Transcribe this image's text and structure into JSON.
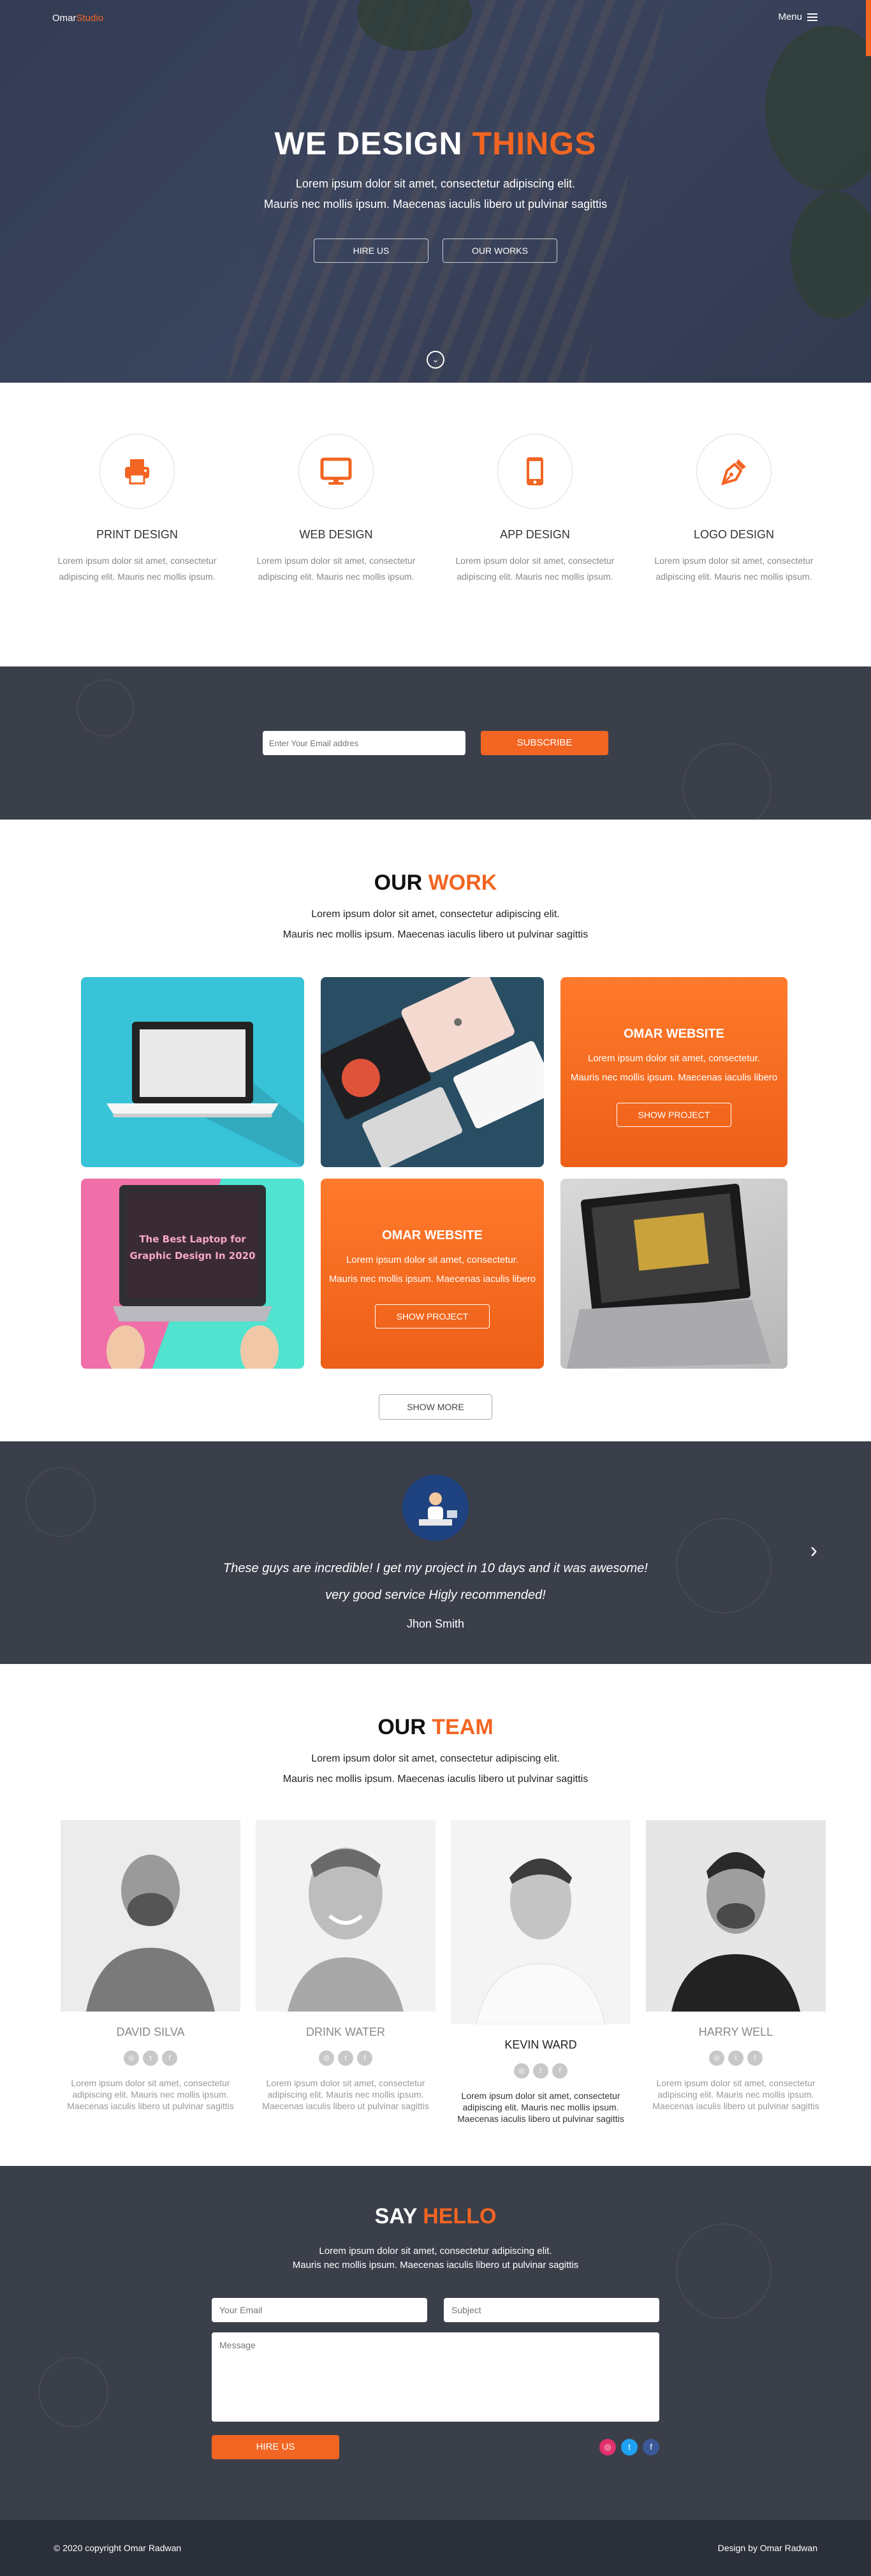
{
  "nav": {
    "logo_main": "Omar",
    "logo_accent": "Studio",
    "menu_label": "Menu"
  },
  "hero": {
    "title_main": "WE DESIGN ",
    "title_accent": "THINGS",
    "subtitle_line1": "Lorem ipsum dolor sit amet, consectetur adipiscing elit.",
    "subtitle_line2": "Mauris nec mollis ipsum. Maecenas iaculis libero ut pulvinar sagittis",
    "button_hire": "HIRE US",
    "button_works": "OUR WORKS"
  },
  "services": [
    {
      "title": "PRINT DESIGN",
      "text": "Lorem ipsum dolor sit amet, consectetur adipiscing elit. Mauris nec mollis ipsum.",
      "icon": "printer-icon"
    },
    {
      "title": "WEB DESIGN",
      "text": "Lorem ipsum dolor sit amet, consectetur adipiscing elit. Mauris nec mollis ipsum.",
      "icon": "monitor-icon"
    },
    {
      "title": "APP DESIGN",
      "text": "Lorem ipsum dolor sit amet, consectetur adipiscing elit. Mauris nec mollis ipsum.",
      "icon": "mobile-icon"
    },
    {
      "title": "LOGO DESIGN",
      "text": "Lorem ipsum dolor sit amet, consectetur adipiscing elit. Mauris nec mollis ipsum.",
      "icon": "pen-nib-icon"
    }
  ],
  "subscribe": {
    "placeholder": "Enter Your Email addres",
    "button": "SUBSCRIBE"
  },
  "work": {
    "title_main": "OUR ",
    "title_accent": "WORK",
    "sub_line1": "Lorem ipsum dolor sit amet, consectetur adipiscing elit.",
    "sub_line2": "Mauris nec mollis ipsum. Maecenas iaculis libero ut pulvinar sagittis",
    "overlay_title": "OMAR WEBSITE",
    "overlay_line1": "Lorem ipsum dolor sit amet, consectetur.",
    "overlay_line2": "Mauris nec mollis ipsum. Maecenas iaculis libero",
    "overlay_button": "SHOW PROJECT",
    "laptop_card_line1": "The Best Laptop for",
    "laptop_card_line2": "Graphic Design In 2020",
    "show_more": "SHOW MORE"
  },
  "testimonial": {
    "quote_line1": "These guys are incredible! I get my project in 10 days and it was awesome!",
    "quote_line2": "very good service Higly recommended!",
    "author": "Jhon Smith"
  },
  "team": {
    "title_main": "OUR ",
    "title_accent": "TEAM",
    "sub_line1": "Lorem ipsum dolor sit amet, consectetur adipiscing elit.",
    "sub_line2": "Mauris nec mollis ipsum. Maecenas iaculis libero ut pulvinar sagittis",
    "members": [
      {
        "name": "DAVID SILVA",
        "text": "Lorem ipsum dolor sit amet, consectetur adipiscing elit. Mauris nec mollis ipsum. Maecenas iaculis libero ut pulvinar sagittis"
      },
      {
        "name": "DRINK WATER",
        "text": "Lorem ipsum dolor sit amet, consectetur adipiscing elit. Mauris nec mollis ipsum. Maecenas iaculis libero ut pulvinar sagittis"
      },
      {
        "name": "KEVIN WARD",
        "text": "Lorem ipsum dolor sit amet, consectetur adipiscing elit. Mauris nec mollis ipsum. Maecenas iaculis libero ut pulvinar sagittis"
      },
      {
        "name": "HARRY WELL",
        "text": "Lorem ipsum dolor sit amet, consectetur adipiscing elit. Mauris nec mollis ipsum. Maecenas iaculis libero ut pulvinar sagittis"
      }
    ]
  },
  "contact": {
    "title_main": "SAY ",
    "title_accent": "HELLO",
    "sub_line1": "Lorem ipsum dolor sit amet, consectetur adipiscing elit.",
    "sub_line2": "Mauris nec mollis ipsum. Maecenas iaculis libero ut pulvinar sagittis",
    "email_placeholder": "Your Email",
    "subject_placeholder": "Subject",
    "message_placeholder": "Message",
    "button": "HIRE US"
  },
  "footer": {
    "copyright": "© 2020 copyright Omar Radwan",
    "credit": "Design by Omar Radwan"
  },
  "colors": {
    "accent": "#f26522",
    "dark": "#3b3f4a"
  }
}
